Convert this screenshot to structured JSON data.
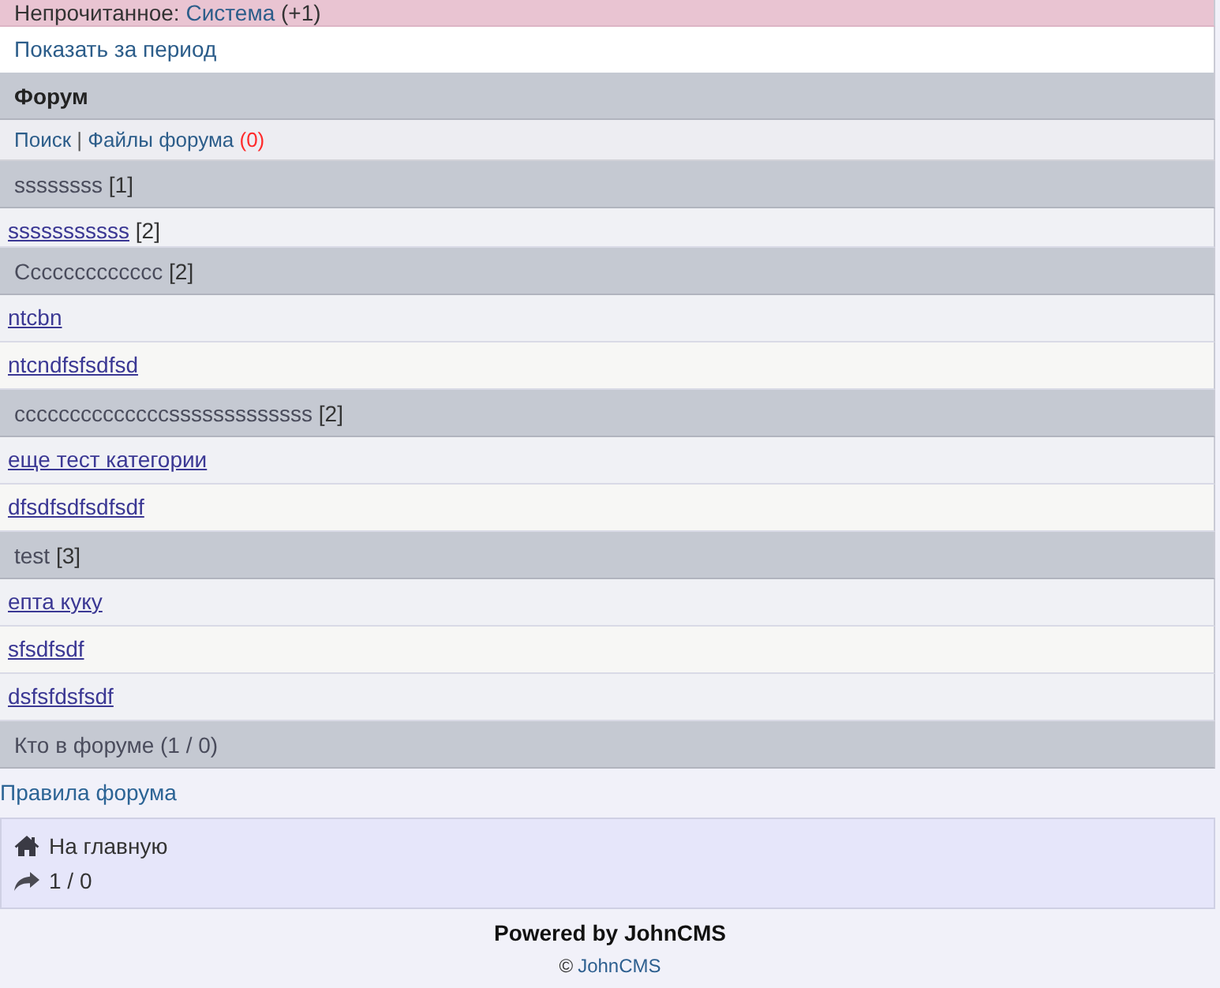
{
  "notice": {
    "label": "Непрочитанное:",
    "link": "Система",
    "count": "(+1)"
  },
  "period_link": "Показать за период",
  "forum": {
    "title": "Форум",
    "menu": {
      "search": "Поиск",
      "separator": "|",
      "files": "Файлы форума",
      "files_count": "(0)"
    }
  },
  "sections": [
    {
      "title": "ssssssss",
      "count": "[1]",
      "items": [
        {
          "label": "sssssssssss",
          "count": "[2]"
        }
      ]
    },
    {
      "title": "Ccccccccccccc",
      "count": "[2]",
      "items": [
        {
          "label": "ntcbn"
        },
        {
          "label": "ntcndfsfsdfsd"
        }
      ]
    },
    {
      "title": "ccccccccccccccsssssssssssss",
      "count": "[2]",
      "items": [
        {
          "label": "еще тест категории"
        },
        {
          "label": "dfsdfsdfsdfsdf"
        }
      ]
    },
    {
      "title": "test",
      "count": "[3]",
      "items": [
        {
          "label": "епта куку"
        },
        {
          "label": "sfsdfsdf"
        },
        {
          "label": "dsfsfdsfsdf"
        }
      ]
    }
  ],
  "online": "Кто в форуме (1 / 0)",
  "rules_link": "Правила форума",
  "nav": [
    {
      "kind": "home",
      "label": "На главную"
    },
    {
      "kind": "share",
      "label": "1 / 0"
    }
  ],
  "footer": {
    "powered": "Powered by JohnCMS",
    "copyright_sign": "©",
    "copyright_link": "JohnCMS"
  }
}
